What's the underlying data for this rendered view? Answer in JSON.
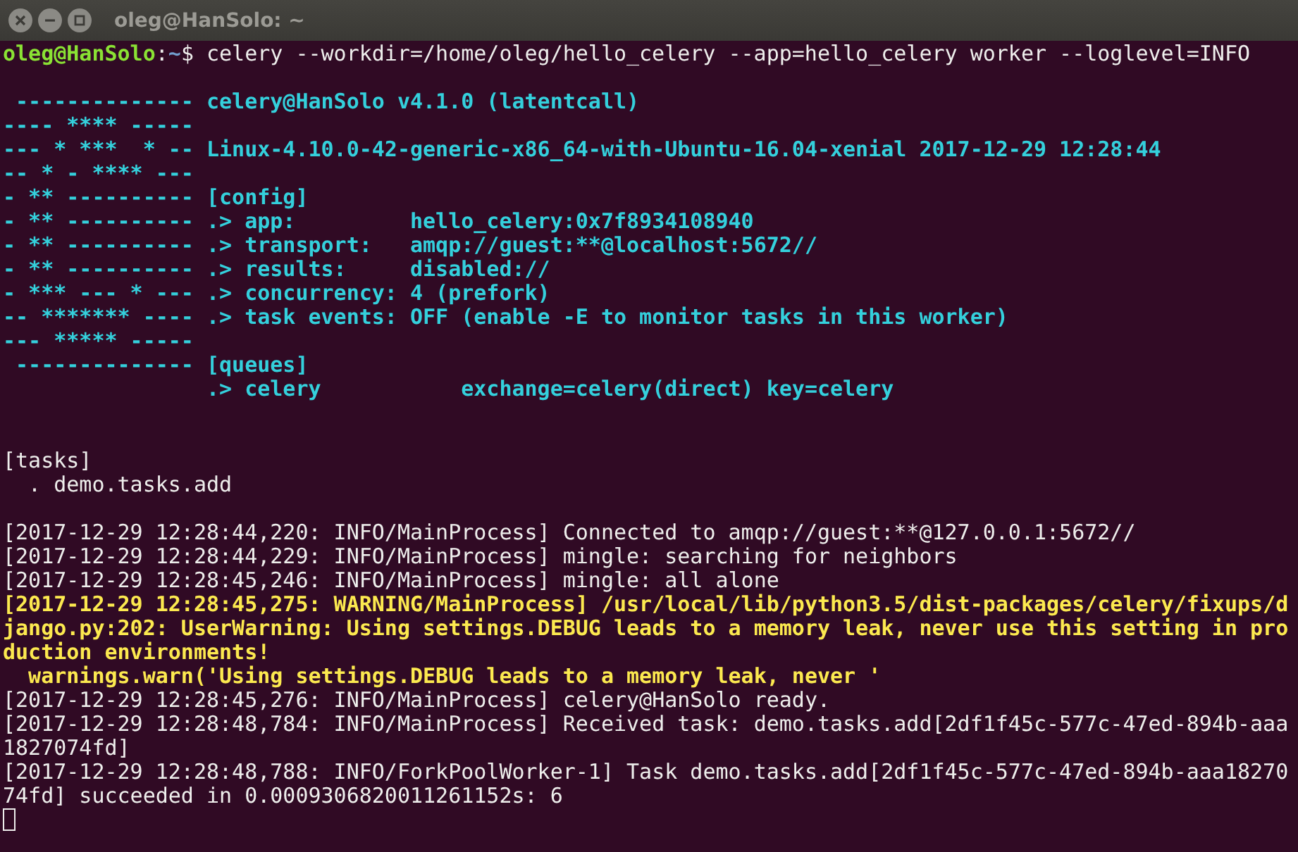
{
  "window": {
    "title": "oleg@HanSolo: ~",
    "buttons": [
      {
        "kind": "close"
      },
      {
        "kind": "minimize"
      },
      {
        "kind": "maximize"
      }
    ]
  },
  "terminal": {
    "lines": [
      {
        "kind": "prompt",
        "user": "oleg@HanSolo",
        "separator": ":",
        "path": "~",
        "symbol": "$",
        "command": "celery --workdir=/home/oleg/hello_celery --app=hello_celery worker --loglevel=INFO"
      },
      {
        "kind": "blank"
      },
      {
        "kind": "banner",
        "text": " -------------- celery@HanSolo v4.1.0 (latentcall)"
      },
      {
        "kind": "banner",
        "text": "---- **** ----- "
      },
      {
        "kind": "banner",
        "text": "--- * ***  * -- Linux-4.10.0-42-generic-x86_64-with-Ubuntu-16.04-xenial 2017-12-29 12:28:44"
      },
      {
        "kind": "banner",
        "text": "-- * - **** --- "
      },
      {
        "kind": "banner",
        "text": "- ** ---------- [config]"
      },
      {
        "kind": "banner",
        "text": "- ** ---------- .> app:         hello_celery:0x7f8934108940"
      },
      {
        "kind": "banner",
        "text": "- ** ---------- .> transport:   amqp://guest:**@localhost:5672//"
      },
      {
        "kind": "banner",
        "text": "- ** ---------- .> results:     disabled://"
      },
      {
        "kind": "banner",
        "text": "- *** --- * --- .> concurrency: 4 (prefork)"
      },
      {
        "kind": "banner",
        "text": "-- ******* ---- .> task events: OFF (enable -E to monitor tasks in this worker)"
      },
      {
        "kind": "banner",
        "text": "--- ***** ----- "
      },
      {
        "kind": "banner",
        "text": " -------------- [queues]"
      },
      {
        "kind": "banner",
        "text": "                .> celery           exchange=celery(direct) key=celery"
      },
      {
        "kind": "blank"
      },
      {
        "kind": "blank"
      },
      {
        "kind": "plain",
        "text": "[tasks]"
      },
      {
        "kind": "plain",
        "text": "  . demo.tasks.add"
      },
      {
        "kind": "blank"
      },
      {
        "kind": "plain",
        "text": "[2017-12-29 12:28:44,220: INFO/MainProcess] Connected to amqp://guest:**@127.0.0.1:5672//"
      },
      {
        "kind": "plain",
        "text": "[2017-12-29 12:28:44,229: INFO/MainProcess] mingle: searching for neighbors"
      },
      {
        "kind": "plain",
        "text": "[2017-12-29 12:28:45,246: INFO/MainProcess] mingle: all alone"
      },
      {
        "kind": "warning",
        "text": "[2017-12-29 12:28:45,275: WARNING/MainProcess] /usr/local/lib/python3.5/dist-packages/celery/fixups/d"
      },
      {
        "kind": "warning",
        "text": "jango.py:202: UserWarning: Using settings.DEBUG leads to a memory leak, never use this setting in pro"
      },
      {
        "kind": "warning",
        "text": "duction environments!"
      },
      {
        "kind": "warning",
        "text": "  warnings.warn('Using settings.DEBUG leads to a memory leak, never '"
      },
      {
        "kind": "plain",
        "text": "[2017-12-29 12:28:45,276: INFO/MainProcess] celery@HanSolo ready."
      },
      {
        "kind": "plain",
        "text": "[2017-12-29 12:28:48,784: INFO/MainProcess] Received task: demo.tasks.add[2df1f45c-577c-47ed-894b-aaa"
      },
      {
        "kind": "plain",
        "text": "1827074fd]"
      },
      {
        "kind": "plain",
        "text": "[2017-12-29 12:28:48,788: INFO/ForkPoolWorker-1] Task demo.tasks.add[2df1f45c-577c-47ed-894b-aaa18270"
      },
      {
        "kind": "plain",
        "text": "74fd] succeeded in 0.0009306820011261152s: 6"
      },
      {
        "kind": "cursor"
      }
    ]
  }
}
